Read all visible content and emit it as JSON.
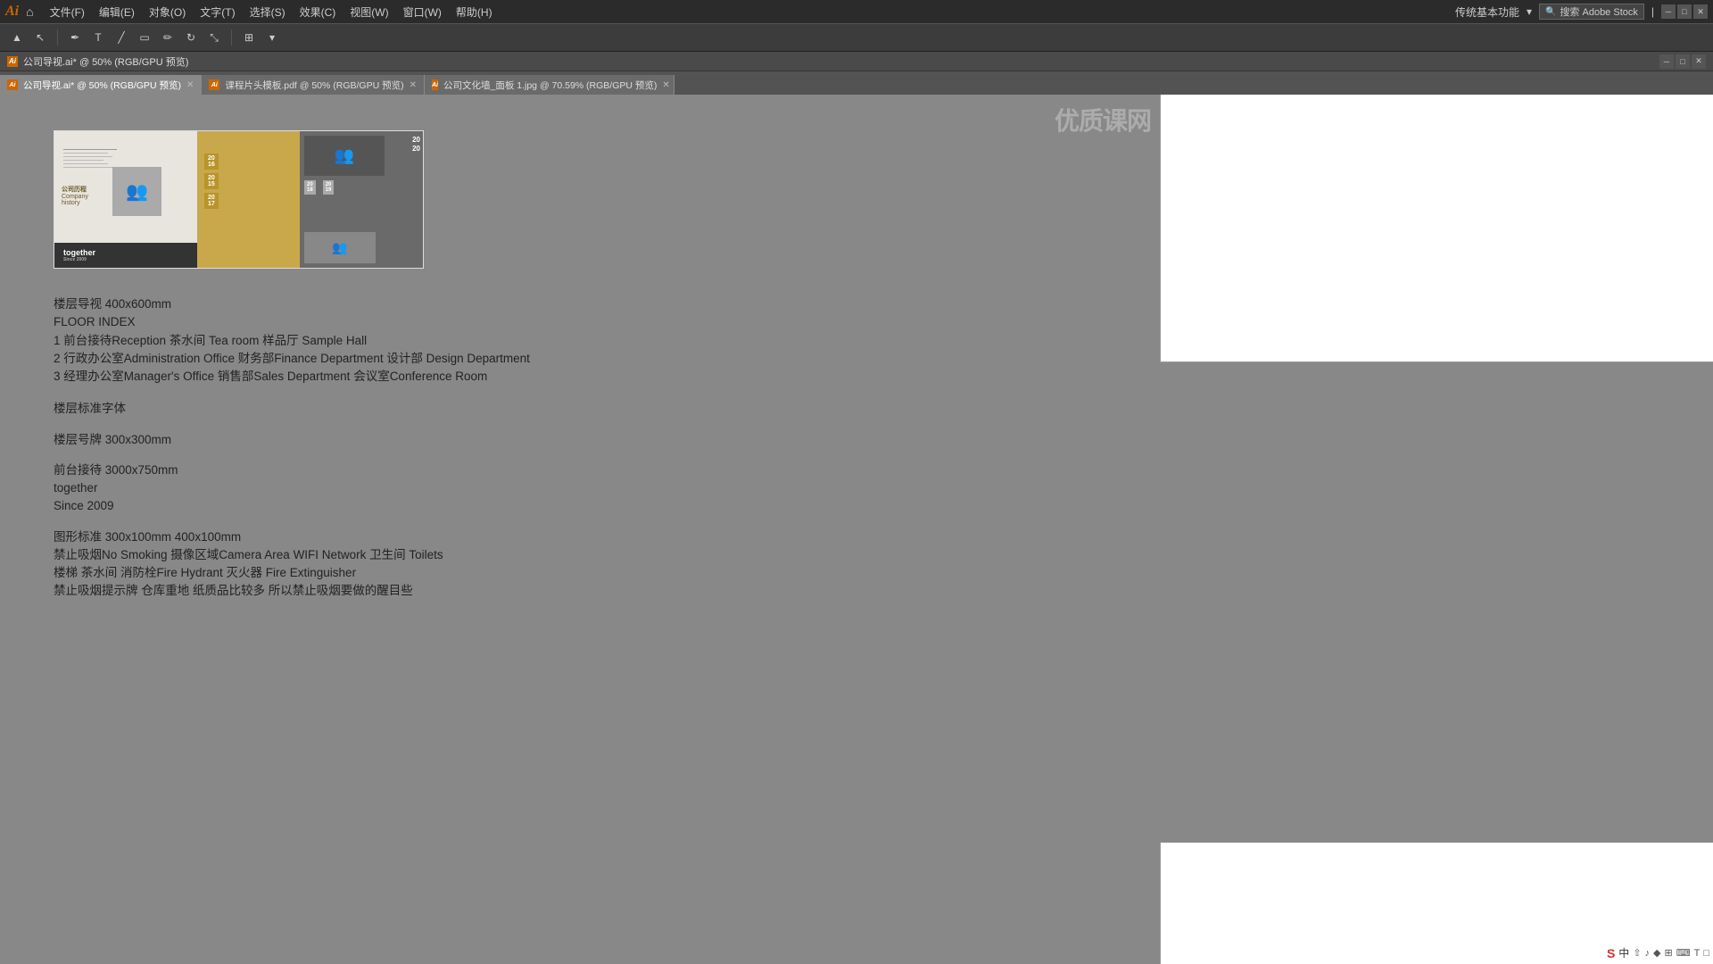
{
  "app": {
    "logo": "Ai",
    "title": "Adobe Illustrator"
  },
  "menu": {
    "items": [
      "文件(F)",
      "编辑(E)",
      "对象(O)",
      "文字(T)",
      "选择(S)",
      "效果(C)",
      "视图(W)",
      "窗口(W)",
      "帮助(H)"
    ],
    "right_text": "传统基本功能",
    "search_placeholder": "搜索 Adobe Stock",
    "layout_icon": "⊞"
  },
  "tabs": [
    {
      "label": "公司导视.ai* @ 50% (RGB/GPU 预览)",
      "active": true,
      "closable": true
    },
    {
      "label": "课程片头模板.pdf @ 50% (RGB/GPU 预览)",
      "active": false,
      "closable": true
    },
    {
      "label": "公司文化墙_面板 1.jpg @ 70.59% (RGB/GPU 预览)",
      "active": false,
      "closable": true
    }
  ],
  "doc_title": "公司导视.ai* @ 50% (RGB/GPU 预览)",
  "text_sections": {
    "floor_index_title": "楼层导视 400x600mm",
    "floor_index_subtitle": "FLOOR INDEX",
    "floor1": "1  前台接待Reception  茶水间 Tea room 样品厅 Sample Hall",
    "floor2": "2 行政办公室Administration Office 财务部Finance Department 设计部 Design Department",
    "floor3": "3 经理办公室Manager's Office 销售部Sales Department 会议室Conference Room",
    "font_title": "楼层标准字体",
    "floor_sign": "楼层号牌 300x300mm",
    "reception_title": "前台接待 3000x750mm",
    "reception_together": "together",
    "reception_since": "Since 2009",
    "graphics_title": "图形标准 300x100mm  400x100mm",
    "graphics_items": "禁止吸烟No Smoking 摄像区域Camera Area WIFI Network 卫生间 Toilets",
    "graphics_items2": "楼梯 茶水间 消防栓Fire Hydrant 灭火器 Fire Extinguisher",
    "graphics_note": "禁止吸烟提示牌 仓库重地 纸质品比较多 所以禁止吸烟要做的醒目些"
  },
  "watermark": "优质课网",
  "status": {
    "doc_info": "公司导视.ai*",
    "zoom": "50%",
    "color": "RGB/GPU 预览"
  },
  "ime_icons": [
    "S",
    "中",
    "⇧",
    "♪",
    "♦",
    "▦",
    "⌨",
    "T",
    "□"
  ]
}
